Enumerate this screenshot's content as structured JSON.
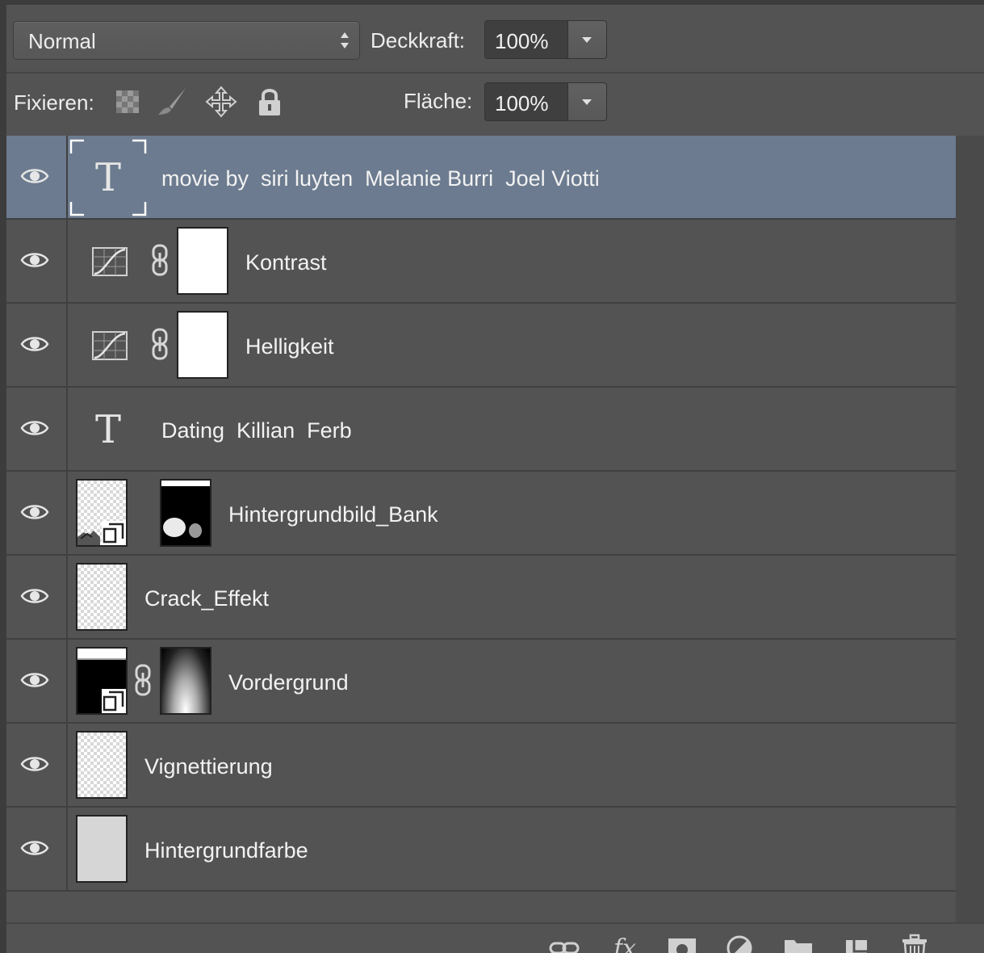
{
  "options": {
    "blend_mode": "Normal",
    "opacity_label": "Deckkraft:",
    "opacity_value": "100%",
    "lock_label": "Fixieren:",
    "fill_label": "Fläche:",
    "fill_value": "100%"
  },
  "layers": [
    {
      "name": "movie by  siri luyten  Melanie Burri  Joel Viotti",
      "type": "text",
      "selected": true
    },
    {
      "name": "Kontrast",
      "type": "adjustment"
    },
    {
      "name": "Helligkeit",
      "type": "adjustment"
    },
    {
      "name": "Dating  Killian  Ferb",
      "type": "text"
    },
    {
      "name": "Hintergrundbild_Bank",
      "type": "smart-object-mask"
    },
    {
      "name": "Crack_Effekt",
      "type": "raster"
    },
    {
      "name": "Vordergrund",
      "type": "smart-object-mask"
    },
    {
      "name": "Vignettierung",
      "type": "raster"
    },
    {
      "name": "Hintergrundfarbe",
      "type": "raster"
    }
  ],
  "icons": {
    "visibility": "eye-icon",
    "lock_transparent": "checkerboard-icon",
    "lock_paint": "brush-icon",
    "lock_move": "move-arrows-icon",
    "lock_all": "padlock-icon",
    "bottom": [
      "link-icon",
      "fx-icon",
      "mask-icon",
      "adjustment-icon",
      "folder-icon",
      "new-layer-icon",
      "trash-icon"
    ]
  },
  "colors": {
    "panel_bg": "#535353",
    "selected_row": "#6c7b8f"
  }
}
